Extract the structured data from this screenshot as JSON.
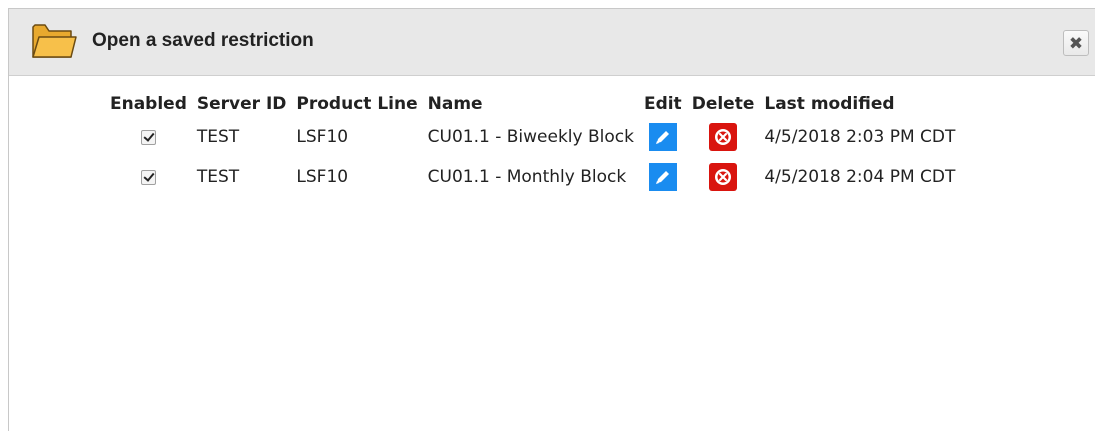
{
  "dialog": {
    "title": "Open a saved restriction",
    "close_label": "✖"
  },
  "table": {
    "headers": {
      "enabled": "Enabled",
      "server_id": "Server ID",
      "product_line": "Product Line",
      "name": "Name",
      "edit": "Edit",
      "delete": "Delete",
      "last_modified": "Last modified"
    },
    "rows": [
      {
        "enabled": true,
        "server_id": "TEST",
        "product_line": "LSF10",
        "name": "CU01.1 - Biweekly Block",
        "last_modified": "4/5/2018 2:03 PM CDT"
      },
      {
        "enabled": true,
        "server_id": "TEST",
        "product_line": "LSF10",
        "name": "CU01.1 - Monthly Block",
        "last_modified": "4/5/2018 2:04 PM CDT"
      }
    ]
  },
  "colors": {
    "titlebar_bg": "#e8e8e8",
    "folder_fill": "#f7c04a",
    "edit_blue": "#1a8cf0",
    "delete_red": "#d9140e"
  },
  "icons": {
    "title": "folder-icon",
    "close": "close-icon",
    "edit": "pencil-icon",
    "delete": "delete-icon"
  }
}
